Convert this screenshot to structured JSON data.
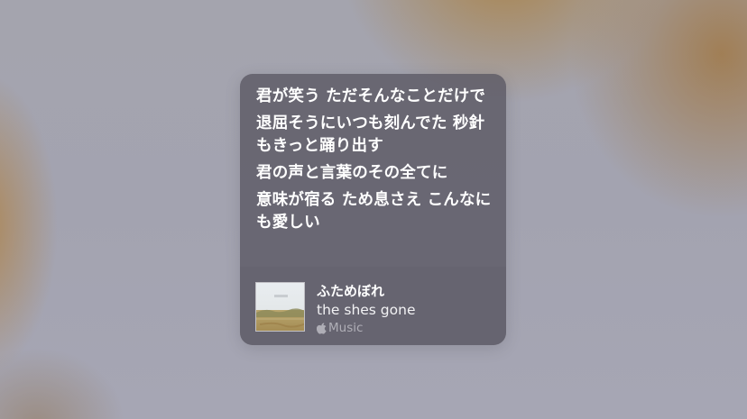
{
  "lyrics": {
    "lines": [
      "君が笑う ただそんなことだけで",
      "退屈そうにいつも刻んでた 秒針もきっと踊り出す",
      "君の声と言葉のその全てに",
      "意味が宿る ため息さえ こんなにも愛しい"
    ]
  },
  "now_playing": {
    "title": "ふためぼれ",
    "artist": "the shes gone",
    "source_label": "Music",
    "source_icon": "apple-icon"
  },
  "colors": {
    "card_background": "#58566280",
    "text_primary": "#ffffff",
    "text_secondary": "#b8b8c0"
  }
}
